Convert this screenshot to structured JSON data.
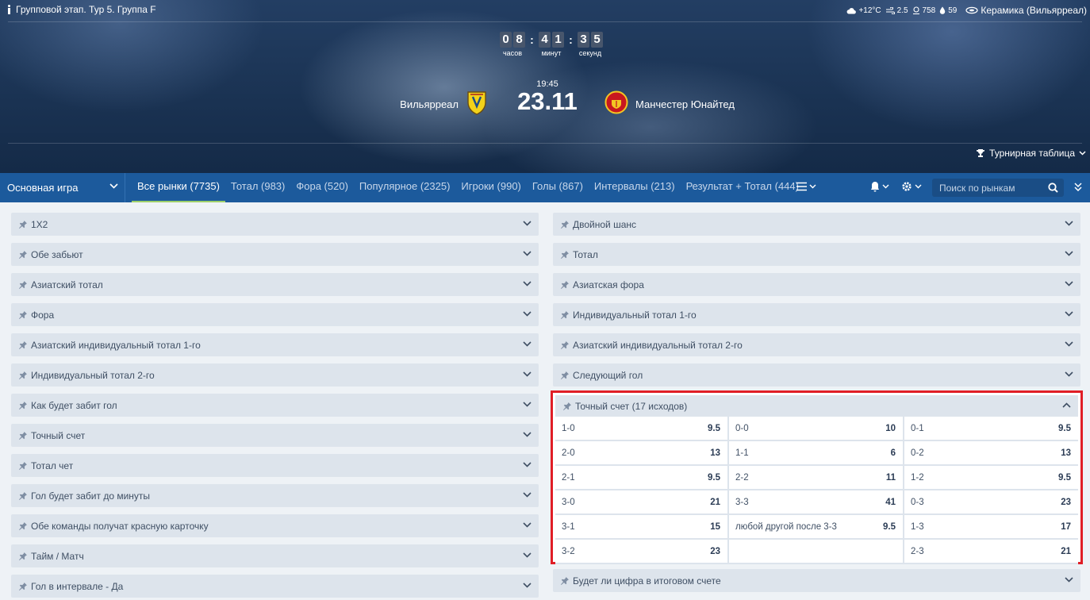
{
  "header": {
    "stage": "Групповой этап. Тур 5. Группа F",
    "weather": {
      "temp": "+12°C",
      "wind": "2.5",
      "pressure": "758",
      "humidity": "59"
    },
    "stadium": "Керамика (Вильярреал)",
    "timer": {
      "hours": [
        "0",
        "8"
      ],
      "minutes": [
        "4",
        "1"
      ],
      "seconds": [
        "3",
        "5"
      ],
      "hours_label": "часов",
      "minutes_label": "минут",
      "seconds_label": "секунд"
    },
    "team1": "Вильярреал",
    "team2": "Манчестер Юнайтед",
    "time": "19:45",
    "date": "23.11",
    "standings": "Турнирная таблица"
  },
  "nav": {
    "selector": "Основная игра",
    "tabs": [
      "Все рынки (7735)",
      "Тотал (983)",
      "Фора (520)",
      "Популярное (2325)",
      "Игроки (990)",
      "Голы (867)",
      "Интервалы (213)",
      "Результат + Тотал (444)"
    ],
    "search_placeholder": "Поиск по рынкам"
  },
  "markets_left": [
    "1X2",
    "Обе забьют",
    "Азиатский тотал",
    "Фора",
    "Азиатский индивидуальный тотал 1-го",
    "Индивидуальный тотал 2-го",
    "Как будет забит гол",
    "Точный счет",
    "Тотал чет",
    "Гол будет забит до минуты",
    "Обе команды получат красную карточку",
    "Тайм / Матч",
    "Гол в интервале - Да"
  ],
  "markets_right": [
    "Двойной шанс",
    "Тотал",
    "Азиатская фора",
    "Индивидуальный тотал 1-го",
    "Азиатский индивидуальный тотал 2-го",
    "Следующий гол"
  ],
  "exact_score": {
    "title": "Точный счет (17 исходов)",
    "cells": [
      {
        "label": "1-0",
        "odd": "9.5"
      },
      {
        "label": "0-0",
        "odd": "10"
      },
      {
        "label": "0-1",
        "odd": "9.5"
      },
      {
        "label": "2-0",
        "odd": "13"
      },
      {
        "label": "1-1",
        "odd": "6"
      },
      {
        "label": "0-2",
        "odd": "13"
      },
      {
        "label": "2-1",
        "odd": "9.5"
      },
      {
        "label": "2-2",
        "odd": "11"
      },
      {
        "label": "1-2",
        "odd": "9.5"
      },
      {
        "label": "3-0",
        "odd": "21"
      },
      {
        "label": "3-3",
        "odd": "41"
      },
      {
        "label": "0-3",
        "odd": "23"
      },
      {
        "label": "3-1",
        "odd": "15"
      },
      {
        "label": "любой другой после 3-3",
        "odd": "9.5"
      },
      {
        "label": "1-3",
        "odd": "17"
      },
      {
        "label": "3-2",
        "odd": "23"
      },
      {
        "label": "",
        "odd": ""
      },
      {
        "label": "2-3",
        "odd": "21"
      }
    ]
  },
  "market_after_score": "Будет ли цифра в итоговом счете",
  "colors": {
    "nav": "#1c5a9c",
    "market_bg": "#dde4ec",
    "highlight": "#e01e26",
    "active_tab_underline": "#9ed06a"
  }
}
